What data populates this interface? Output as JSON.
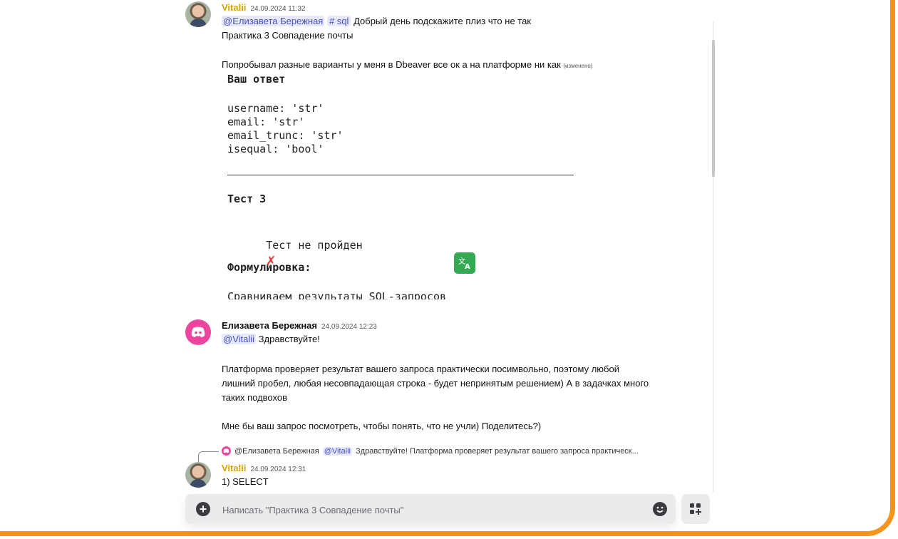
{
  "messages": [
    {
      "author": "Vitalii",
      "time": "24.09.2024 11:32",
      "mention": "@Елизавета Бережная",
      "channel": "sql",
      "text1": "Добрый день подскажите плиз что не так",
      "text2": "Практика 3 Совпадение почты",
      "text3": "Попробывал разные варианты у меня в Dbeaver все ок а на платформе ни как",
      "edited": "(изменено)",
      "screenshot": {
        "heading": "Ваш ответ",
        "lines": [
          "username: 'str'",
          "email: 'str'",
          "email_trunc: 'str'",
          "isequal: 'bool'"
        ],
        "test_title": "Тест 3",
        "test_status": "Тест не пройден",
        "test_mark": "✗",
        "wording_label": "Формулировка:",
        "wording_text": "Сравниваем результаты SQL-запросов"
      }
    },
    {
      "author": "Елизавета Бережная",
      "time": "24.09.2024 12:23",
      "mention": "@Vitalii",
      "text1": "Здравствуйте!",
      "text2": "Платформа проверяет результат вашего запроса практически посимвольно, поэтому любой",
      "text3": "лишний пробел, любая несовпадающая строка - будет непринятым решением) А в задачках много",
      "text4": "таких подвохов",
      "text5": "Мне бы ваш запрос посмотреть, чтобы понять, что не учли) Поделитесь?)"
    },
    {
      "reply_author": "@Елизавета Бережная",
      "reply_mention": "@Vitalii",
      "reply_text": "Здравствуйте!  Платформа проверяет результат вашего запроса практическ...",
      "author": "Vitalii",
      "time": "24.09.2024 12:31",
      "text1": "1) SELECT"
    }
  ],
  "composer": {
    "placeholder": "Написать \"Практика 3 Совпадение почты\""
  },
  "colors": {
    "frame": "#f7941d",
    "vitalii_name": "#d4a400",
    "mention_bg": "#e6e8fd",
    "mention_fg": "#4752c4",
    "discord_avatar": "#eb459e",
    "translate_green": "#35a853"
  },
  "icons": [
    "avatar-photo",
    "discord-avatar",
    "translate-icon",
    "plus-icon",
    "emoji-icon",
    "apps-icon"
  ]
}
